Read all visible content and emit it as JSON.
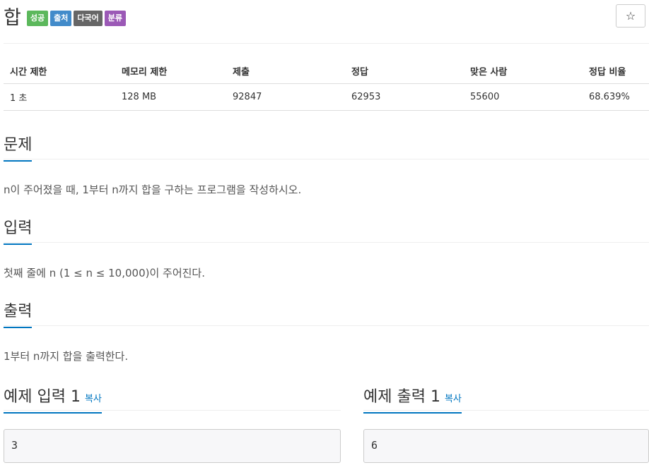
{
  "problem": {
    "title": "합",
    "badges": [
      {
        "label": "성공",
        "color": "#5cb85c"
      },
      {
        "label": "출처",
        "color": "#428bca"
      },
      {
        "label": "다국어",
        "color": "#666666"
      },
      {
        "label": "분류",
        "color": "#9b59b6"
      }
    ],
    "star_icon": "star-icon"
  },
  "info_table": {
    "headers": [
      "시간 제한",
      "메모리 제한",
      "제출",
      "정답",
      "맞은 사람",
      "정답 비율"
    ],
    "values": [
      "1 초",
      "128 MB",
      "92847",
      "62953",
      "55600",
      "68.639%"
    ]
  },
  "sections": {
    "problem": {
      "heading": "문제",
      "body": "n이 주어졌을 때, 1부터 n까지 합을 구하는 프로그램을 작성하시오."
    },
    "input": {
      "heading": "입력",
      "body": "첫째 줄에 n (1 ≤ n ≤ 10,000)이 주어진다."
    },
    "output": {
      "heading": "출력",
      "body": "1부터 n까지 합을 출력한다."
    }
  },
  "samples": {
    "input": {
      "heading": "예제 입력 1",
      "copy_label": "복사",
      "value": "3"
    },
    "output": {
      "heading": "예제 출력 1",
      "copy_label": "복사",
      "value": "6"
    }
  },
  "colors": {
    "accent": "#0076c0"
  }
}
